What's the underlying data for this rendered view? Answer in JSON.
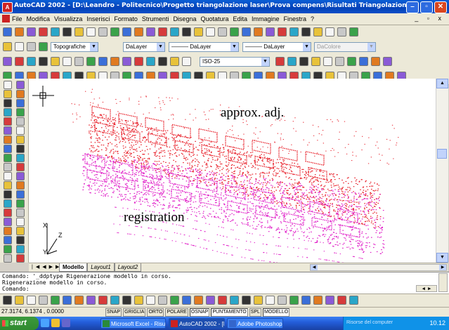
{
  "window": {
    "title": "AutoCAD 2002 - [D:\\Leandro - Politecnico\\Progetto triangolazione laser\\Prova compens\\Risultati Triangolazione.dwg]",
    "app_icon": "autocad-logo-icon"
  },
  "menu": [
    "File",
    "Modifica",
    "Visualizza",
    "Inserisci",
    "Formato",
    "Strumenti",
    "Disegna",
    "Quotatura",
    "Edita",
    "Immagine",
    "Finestra",
    "?"
  ],
  "mdi_controls": "_ ▫ x",
  "toolbar2": {
    "layer_combo": "Topografiche",
    "color_combo": "DaLayer",
    "linetype_combo": "——— DaLayer",
    "lineweight_combo": "——— DaLayer",
    "plotstyle_combo": "DaColore"
  },
  "toolbar3": {
    "dimstyle_combo": "ISO-25"
  },
  "annotations": {
    "top": "approx. adj.",
    "bottom": "registration"
  },
  "ucs": {
    "x_label": "X",
    "y_label": "Y",
    "z_label": "Z"
  },
  "layout_tabs": [
    "Modello",
    "Layout1",
    "Layout2"
  ],
  "active_tab": "Modello",
  "command_history": [
    "Comando:  '_ddptype Rigenerazione modello in corso.",
    "Rigenerazione modello in corso.",
    "Comando:"
  ],
  "status": {
    "coordinates": "27.3174,  6.1374 , 0.0000",
    "modes": [
      {
        "label": "SNAP",
        "on": false
      },
      {
        "label": "GRIGLIA",
        "on": false
      },
      {
        "label": "ORTO",
        "on": false
      },
      {
        "label": "POLARE",
        "on": false
      },
      {
        "label": "OSNAP",
        "on": true
      },
      {
        "label": "PUNTAMENTO",
        "on": true
      },
      {
        "label": "SPL",
        "on": false
      },
      {
        "label": "MODELLO",
        "on": true
      }
    ]
  },
  "taskbar": {
    "start": "start",
    "items": [
      {
        "label": "Microsoft Excel - Risul...",
        "active": false
      },
      {
        "label": "AutoCAD 2002 - [D:\\...",
        "active": true
      },
      {
        "label": "Adobe Photoshop",
        "active": false
      }
    ],
    "tray_text": "Risorse del computer",
    "clock": "10.12"
  },
  "colors": {
    "approx_adj": "#e8202a",
    "registration": "#e020c8",
    "xp_blue": "#245edb",
    "toolbar_bg": "#ece9d8"
  }
}
